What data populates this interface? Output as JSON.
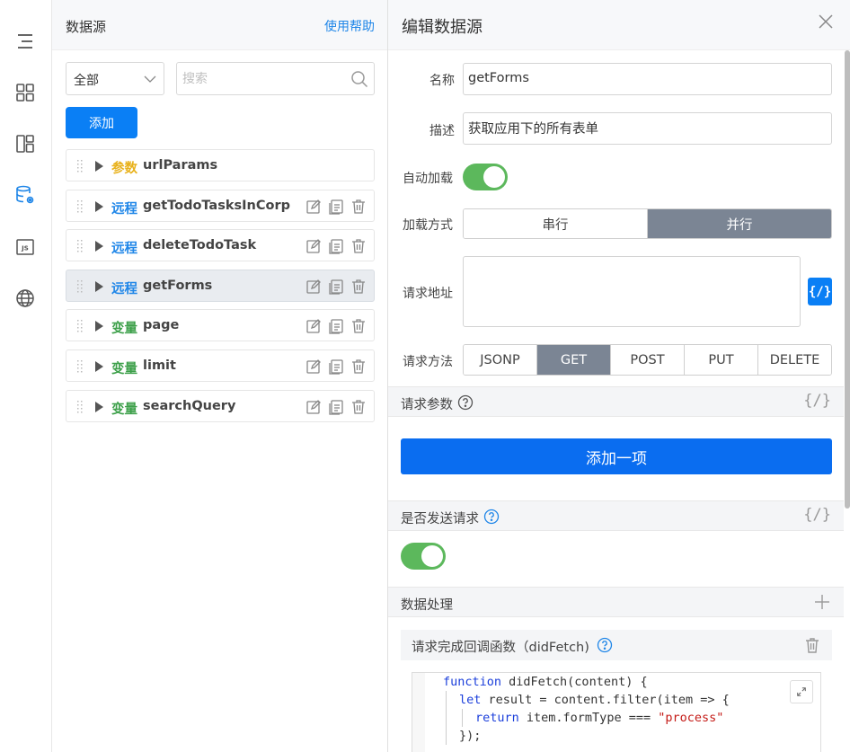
{
  "rail": {
    "icons": [
      "outline-icon",
      "components-icon",
      "layout-icon",
      "datasource-icon",
      "js-icon",
      "globe-icon"
    ],
    "active_color": "#1f86e8"
  },
  "panel": {
    "title": "数据源",
    "help": "使用帮助",
    "filter_value": "全部",
    "search_placeholder": "搜索",
    "add_label": "添加",
    "items": [
      {
        "tag": "参数",
        "kind": "param",
        "name": "urlParams"
      },
      {
        "tag": "远程",
        "kind": "remote",
        "name": "getTodoTasksInCorp"
      },
      {
        "tag": "远程",
        "kind": "remote",
        "name": "deleteTodoTask"
      },
      {
        "tag": "远程",
        "kind": "remote",
        "name": "getForms",
        "active": true
      },
      {
        "tag": "变量",
        "kind": "var",
        "name": "page"
      },
      {
        "tag": "变量",
        "kind": "var",
        "name": "limit"
      },
      {
        "tag": "变量",
        "kind": "var",
        "name": "searchQuery"
      }
    ]
  },
  "editor": {
    "title": "编辑数据源",
    "name_label": "名称",
    "name_value": "getForms",
    "desc_label": "描述",
    "desc_value": "获取应用下的所有表单",
    "autoload_label": "自动加载",
    "autoload_on": true,
    "loadmode_label": "加载方式",
    "loadmode_options": [
      "串行",
      "并行"
    ],
    "loadmode_selected": "并行",
    "url_label": "请求地址",
    "url_value": "",
    "expr_symbol": "{/}",
    "method_label": "请求方法",
    "methods": [
      "JSONP",
      "GET",
      "POST",
      "PUT",
      "DELETE"
    ],
    "method_selected": "GET",
    "params_title": "请求参数",
    "add_item_label": "添加一项",
    "send_title": "是否发送请求",
    "send_on": true,
    "process_title": "数据处理",
    "callback_title": "请求完成回调函数（didFetch)",
    "code_lines": [
      {
        "kw": "function",
        "rest": " didFetch(content) {"
      },
      {
        "kw": "let",
        "rest": " result = content.filter(item => {"
      },
      {
        "kw": "return",
        "rest": " item.formType === ",
        "str": "\"process\""
      },
      {
        "kw": "",
        "rest": "});"
      }
    ]
  }
}
